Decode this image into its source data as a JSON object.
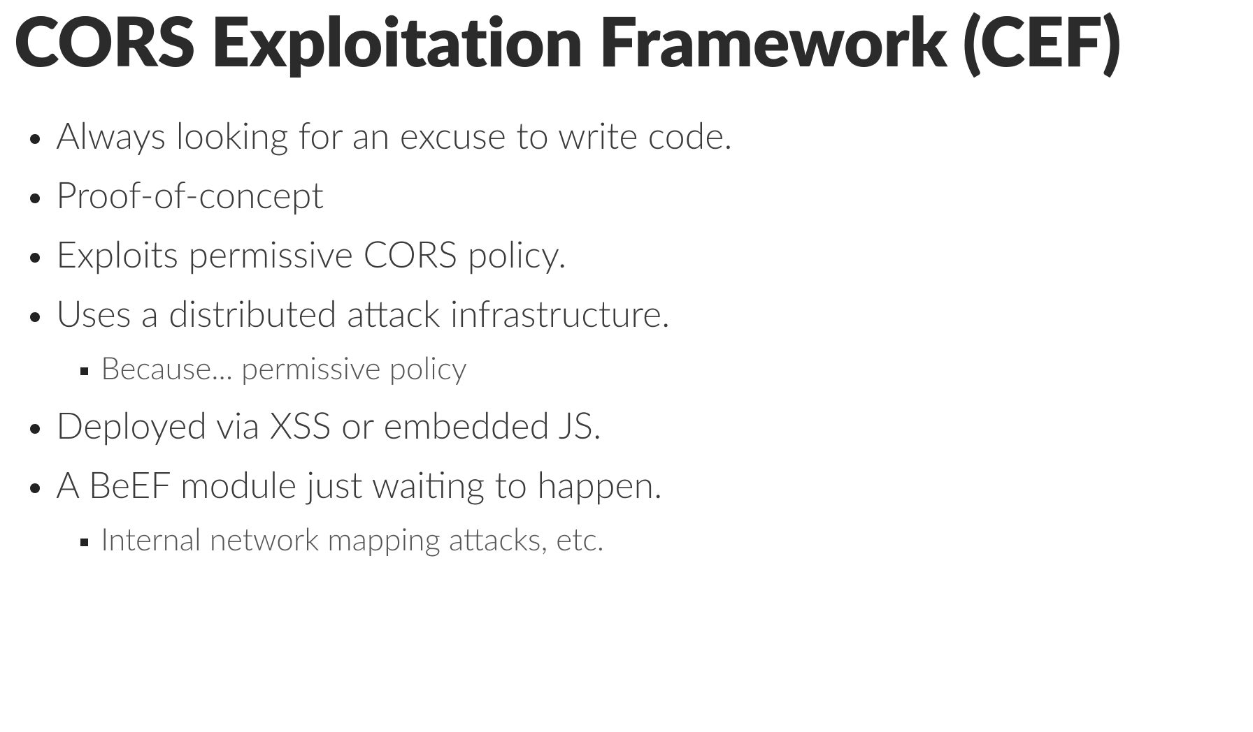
{
  "title": "CORS Exploitation Framework (CEF)",
  "bullets": [
    {
      "text": "Always looking for an excuse to write code.",
      "sub": []
    },
    {
      "text": "Proof-of-concept",
      "sub": []
    },
    {
      "text": "Exploits permissive CORS policy.",
      "sub": []
    },
    {
      "text": "Uses a distributed attack infrastructure.",
      "sub": [
        "Because... permissive policy"
      ]
    },
    {
      "text": "Deployed via XSS or embedded JS.",
      "sub": []
    },
    {
      "text": "A BeEF module just waiting to happen.",
      "sub": [
        "Internal network mapping attacks, etc."
      ]
    }
  ]
}
